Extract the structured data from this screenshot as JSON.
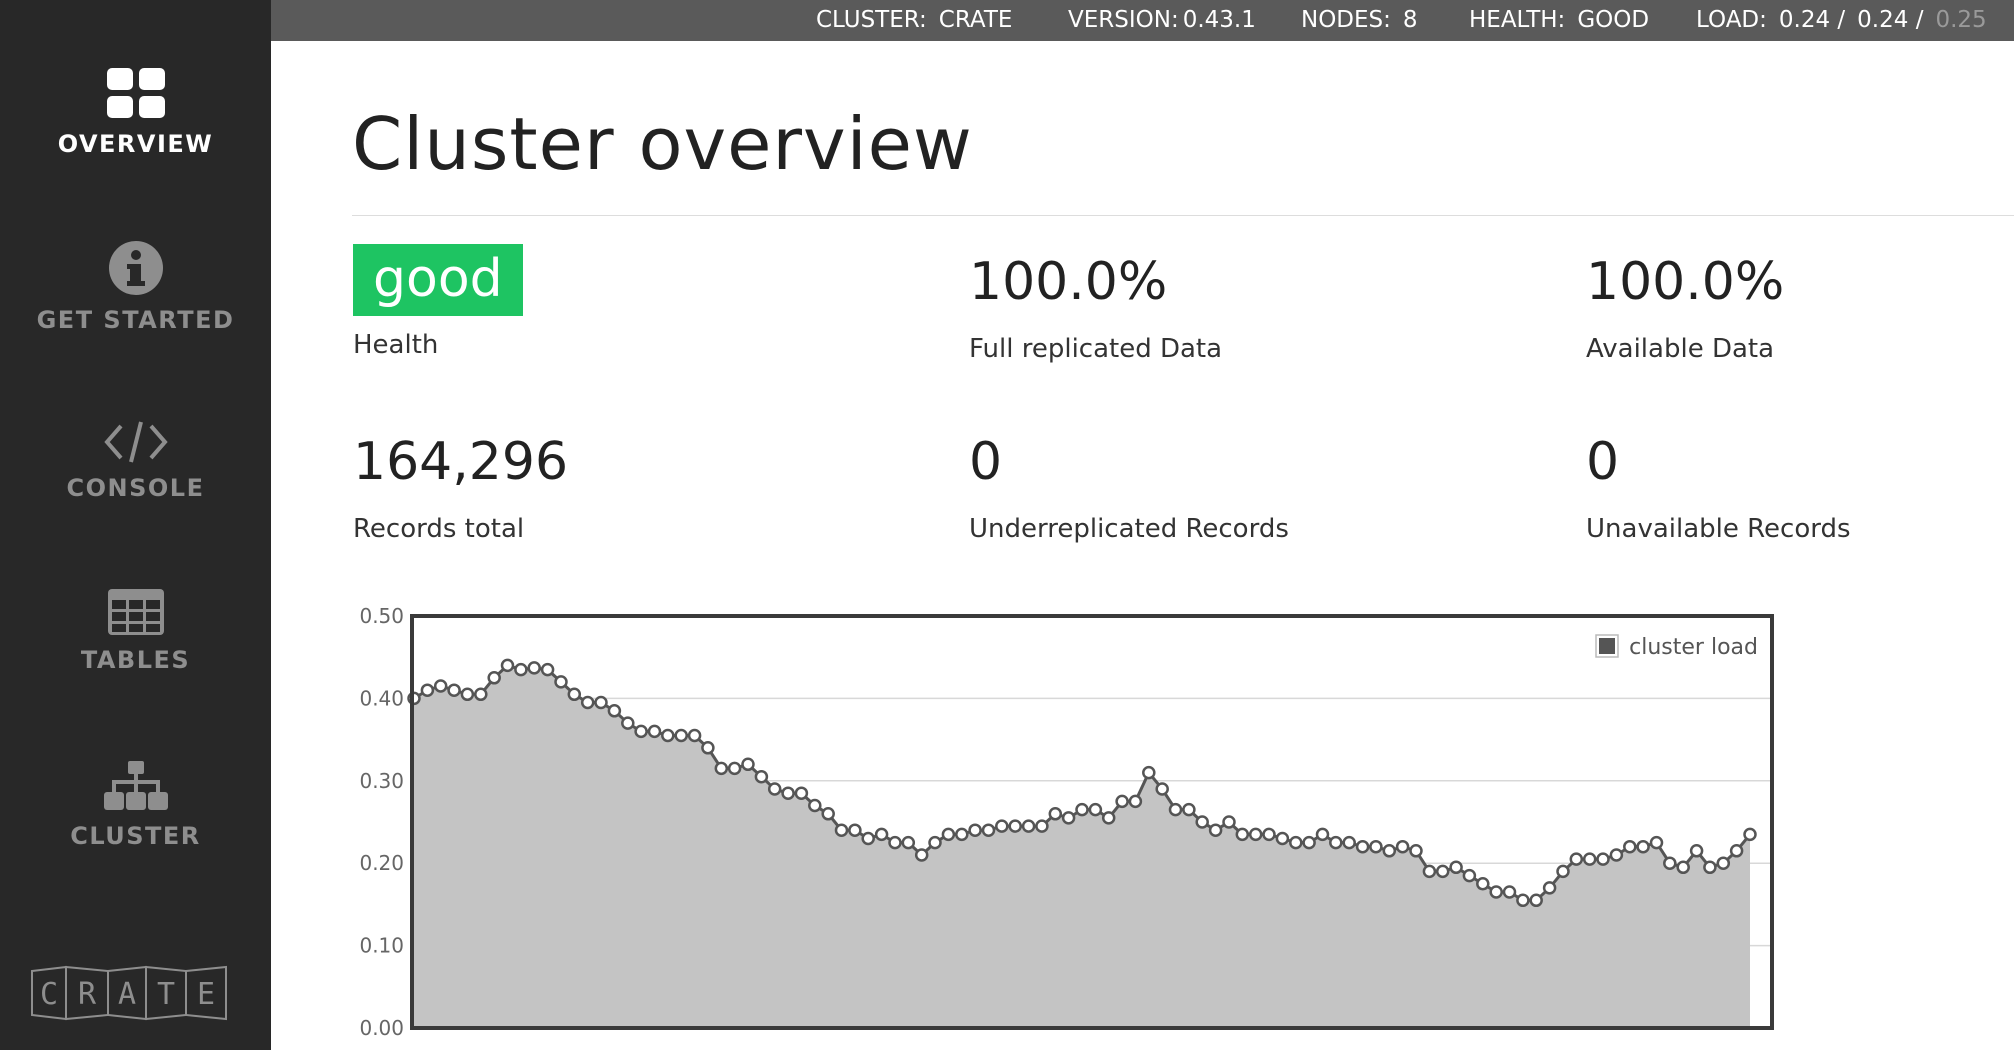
{
  "sidebar": {
    "items": [
      {
        "label": "OVERVIEW",
        "icon": "grid-icon",
        "active": true
      },
      {
        "label": "GET STARTED",
        "icon": "info-icon",
        "active": false
      },
      {
        "label": "CONSOLE",
        "icon": "code-icon",
        "active": false
      },
      {
        "label": "TABLES",
        "icon": "table-icon",
        "active": false
      },
      {
        "label": "CLUSTER",
        "icon": "hierarchy-icon",
        "active": false
      }
    ],
    "logo": {
      "letters": [
        "C",
        "R",
        "A",
        "T",
        "E"
      ]
    }
  },
  "topbar": {
    "cluster_label": "CLUSTER:",
    "cluster_value": "CRATE",
    "version_label": "VERSION:",
    "version_value": "0.43.1",
    "nodes_label": "NODES:",
    "nodes_value": "8",
    "health_label": "HEALTH:",
    "health_value": "GOOD",
    "load_label": "LOAD:",
    "load_1": "0.24 /",
    "load_5": "0.24 /",
    "load_15": "0.25"
  },
  "main": {
    "title": "Cluster overview",
    "metrics": {
      "health": {
        "value": "good",
        "label": "Health"
      },
      "full_replicated": {
        "value": "100.0%",
        "label": "Full replicated Data"
      },
      "available": {
        "value": "100.0%",
        "label": "Available Data"
      },
      "records_total": {
        "value": "164,296",
        "label": "Records total"
      },
      "underreplicated": {
        "value": "0",
        "label": "Underreplicated Records"
      },
      "unavailable": {
        "value": "0",
        "label": "Unavailable Records"
      }
    }
  },
  "colors": {
    "sidebar_bg": "#282828",
    "topbar_bg": "#5a5a5a",
    "health_good": "#1ec462",
    "chart_fill": "#c4c4c4",
    "chart_line": "#555555"
  },
  "chart_data": {
    "type": "area",
    "title": "",
    "xlabel": "",
    "ylabel": "",
    "ylim": [
      0,
      0.5
    ],
    "yticks": [
      "0.00",
      "0.10",
      "0.20",
      "0.30",
      "0.40",
      "0.50"
    ],
    "grid": true,
    "legend_position": "top-right",
    "series": [
      {
        "name": "cluster load",
        "values": [
          0.4,
          0.41,
          0.415,
          0.41,
          0.405,
          0.405,
          0.425,
          0.44,
          0.435,
          0.437,
          0.435,
          0.42,
          0.405,
          0.395,
          0.395,
          0.385,
          0.37,
          0.36,
          0.36,
          0.355,
          0.355,
          0.355,
          0.34,
          0.315,
          0.315,
          0.32,
          0.305,
          0.29,
          0.285,
          0.285,
          0.27,
          0.26,
          0.24,
          0.24,
          0.23,
          0.235,
          0.225,
          0.225,
          0.21,
          0.225,
          0.235,
          0.235,
          0.24,
          0.24,
          0.245,
          0.245,
          0.245,
          0.245,
          0.26,
          0.255,
          0.265,
          0.265,
          0.255,
          0.275,
          0.275,
          0.31,
          0.29,
          0.265,
          0.265,
          0.25,
          0.24,
          0.25,
          0.235,
          0.235,
          0.235,
          0.23,
          0.225,
          0.225,
          0.235,
          0.225,
          0.225,
          0.22,
          0.22,
          0.215,
          0.22,
          0.215,
          0.19,
          0.19,
          0.195,
          0.185,
          0.175,
          0.165,
          0.165,
          0.155,
          0.155,
          0.17,
          0.19,
          0.205,
          0.205,
          0.205,
          0.21,
          0.22,
          0.22,
          0.225,
          0.2,
          0.195,
          0.215,
          0.195,
          0.2,
          0.215,
          0.235
        ]
      }
    ]
  }
}
